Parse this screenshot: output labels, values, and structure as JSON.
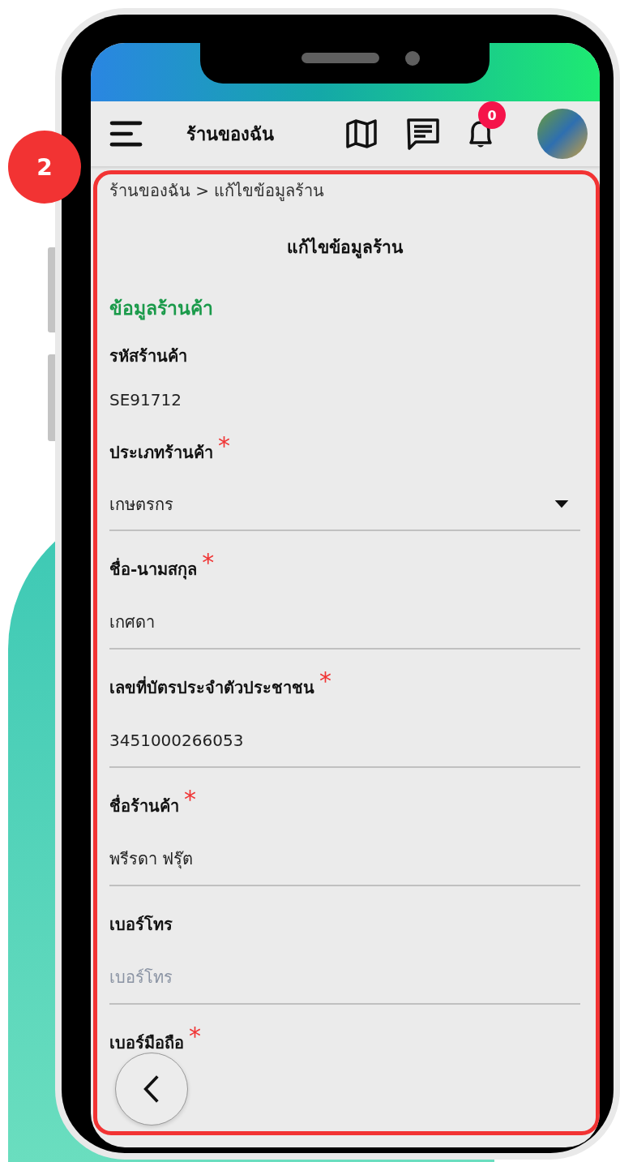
{
  "step_badge": "2",
  "app_bar": {
    "title": "ร้านของฉัน",
    "notification_count": "0"
  },
  "breadcrumb": "ร้านของฉัน > แก้ไขข้อมูลร้าน",
  "page_title": "แก้ไขข้อมูลร้าน",
  "section_title": "ข้อมูลร้านค้า",
  "fields": [
    {
      "kind": "static",
      "label": "รหัสร้านค้า",
      "value": "SE91712"
    },
    {
      "kind": "select",
      "label": "ประเภทร้านค้า",
      "required_mark": "*",
      "value": "เกษตรกร"
    },
    {
      "kind": "input",
      "label": "ชื่อ-นามสกุล",
      "required_mark": "*",
      "value": "เกศดา"
    },
    {
      "kind": "input",
      "label": "เลขที่บัตรประจำตัวประชาชน",
      "required_mark": "*",
      "value": "3451000266053"
    },
    {
      "kind": "input",
      "label": "ชื่อร้านค้า",
      "required_mark": "*",
      "value": "พรีรดา ฟรุ๊ต"
    },
    {
      "kind": "input",
      "label": "เบอร์โทร",
      "placeholder": "เบอร์โทร"
    },
    {
      "kind": "input",
      "label": "เบอร์มือถือ",
      "required_mark": "*"
    }
  ]
}
